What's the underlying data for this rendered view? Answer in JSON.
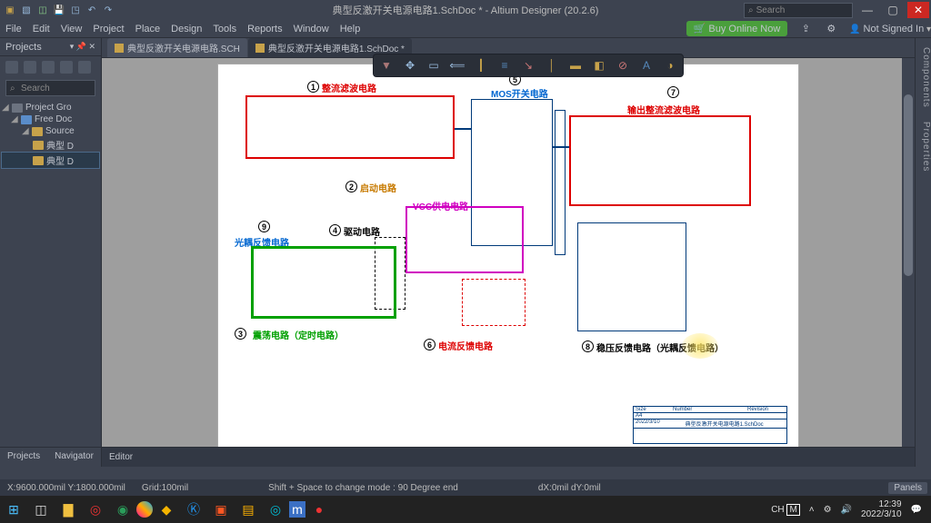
{
  "window": {
    "title": "典型反激开关电源电路1.SchDoc * - Altium Designer (20.2.6)",
    "search_placeholder": "Search"
  },
  "menu": {
    "items": [
      "File",
      "Edit",
      "View",
      "Project",
      "Place",
      "Design",
      "Tools",
      "Reports",
      "Window",
      "Help"
    ],
    "buy": "Buy Online Now",
    "signin": "Not Signed In"
  },
  "projects_panel": {
    "title": "Projects",
    "search_placeholder": "Search",
    "tree": {
      "root": "Project Gro",
      "free": "Free Doc",
      "source": "Source",
      "doc1": "典型 D",
      "doc2": "典型 D"
    },
    "tabs": [
      "Projects",
      "Navigator"
    ]
  },
  "doc_tabs": {
    "tab1": "典型反激开关电源电路.SCH",
    "tab2": "典型反激开关电源电路1.SchDoc *"
  },
  "editor_label": "Editor",
  "right_rail": {
    "a": "Components",
    "b": "Properties"
  },
  "status": {
    "coord": "X:9600.000mil Y:1800.000mil",
    "grid": "Grid:100mil",
    "mode": "Shift + Space to change mode : 90 Degree end",
    "delta": "dX:0mil dY:0mil",
    "panels": "Panels"
  },
  "schematic": {
    "blocks": {
      "b1": {
        "num": "1",
        "label": "整流滤波电路"
      },
      "b2": {
        "num": "2",
        "label": "启动电路"
      },
      "b3": {
        "num": "3",
        "label": "震荡电路（定时电路）"
      },
      "b4": {
        "num": "4",
        "label": "驱动电路"
      },
      "b5": {
        "num": "5",
        "label": "MOS开关电路"
      },
      "b6": {
        "num": "6",
        "label": "电流反馈电路"
      },
      "b7": {
        "num": "7",
        "label": "输出整流滤波电路"
      },
      "b8": {
        "num": "8",
        "label": "稳压反馈电路（光耦反馈电路）"
      },
      "b9": {
        "num": "9",
        "label": "光耦反馈电路"
      },
      "vcc": "VCC供电电路"
    },
    "titleblock": {
      "sheet": "A4",
      "date": "2022/3/10",
      "file": "典型反激开关电源电路1.SchDoc"
    }
  },
  "taskbar": {
    "ime": "CH",
    "time": "12:39",
    "date": "2022/3/10"
  }
}
